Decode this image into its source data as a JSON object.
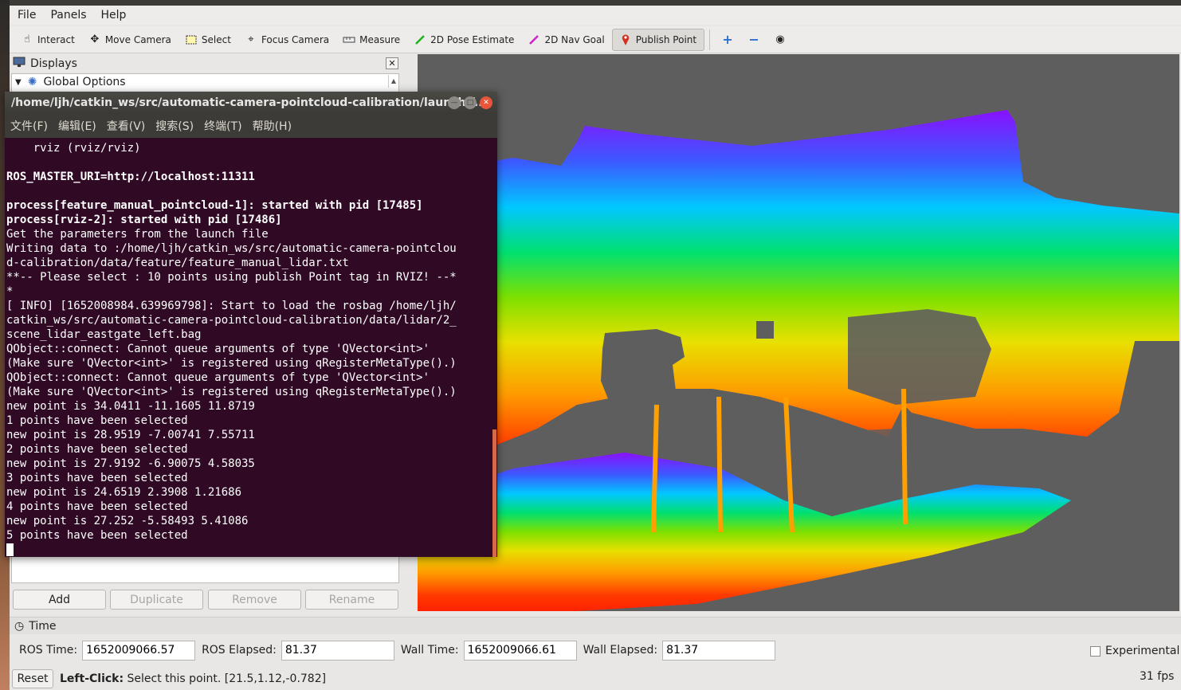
{
  "menubar": {
    "items": [
      "File",
      "Panels",
      "Help"
    ]
  },
  "toolbar": {
    "tools": [
      {
        "label": "Interact",
        "icon": "hand-pointer-icon"
      },
      {
        "label": "Move Camera",
        "icon": "move-camera-icon"
      },
      {
        "label": "Select",
        "icon": "select-box-icon"
      },
      {
        "label": "Focus Camera",
        "icon": "crosshair-icon"
      },
      {
        "label": "Measure",
        "icon": "ruler-icon"
      },
      {
        "label": "2D Pose Estimate",
        "icon": "green-arrow-icon"
      },
      {
        "label": "2D Nav Goal",
        "icon": "magenta-arrow-icon"
      },
      {
        "label": "Publish Point",
        "icon": "map-pin-icon"
      }
    ]
  },
  "displays": {
    "title": "Displays",
    "tree": {
      "global_options": "Global Options"
    },
    "buttons": {
      "add": "Add",
      "duplicate": "Duplicate",
      "remove": "Remove",
      "rename": "Rename"
    }
  },
  "terminal": {
    "title": "/home/ljh/catkin_ws/src/automatic-camera-pointcloud-calibration/launch/f...",
    "menu": [
      "文件(F)",
      "编辑(E)",
      "查看(V)",
      "搜索(S)",
      "终端(T)",
      "帮助(H)"
    ],
    "lines": [
      {
        "text": "    rviz (rviz/rviz)",
        "bold": false
      },
      {
        "text": "",
        "bold": false
      },
      {
        "text": "ROS_MASTER_URI=http://localhost:11311",
        "bold": true
      },
      {
        "text": "",
        "bold": false
      },
      {
        "text": "process[feature_manual_pointcloud-1]: started with pid [17485]",
        "bold": true
      },
      {
        "text": "process[rviz-2]: started with pid [17486]",
        "bold": true
      },
      {
        "text": "Get the parameters from the launch file",
        "bold": false
      },
      {
        "text": "Writing data to :/home/ljh/catkin_ws/src/automatic-camera-pointclou",
        "bold": false
      },
      {
        "text": "d-calibration/data/feature/feature_manual_lidar.txt",
        "bold": false
      },
      {
        "text": "**-- Please select : 10 points using publish Point tag in RVIZ! --*",
        "bold": false
      },
      {
        "text": "*",
        "bold": false
      },
      {
        "text": "[ INFO] [1652008984.639969798]: Start to load the rosbag /home/ljh/",
        "bold": false
      },
      {
        "text": "catkin_ws/src/automatic-camera-pointcloud-calibration/data/lidar/2_",
        "bold": false
      },
      {
        "text": "scene_lidar_eastgate_left.bag",
        "bold": false
      },
      {
        "text": "QObject::connect: Cannot queue arguments of type 'QVector<int>'",
        "bold": false
      },
      {
        "text": "(Make sure 'QVector<int>' is registered using qRegisterMetaType().)",
        "bold": false
      },
      {
        "text": "QObject::connect: Cannot queue arguments of type 'QVector<int>'",
        "bold": false
      },
      {
        "text": "(Make sure 'QVector<int>' is registered using qRegisterMetaType().)",
        "bold": false
      },
      {
        "text": "new point is 34.0411 -11.1605 11.8719",
        "bold": false
      },
      {
        "text": "1 points have been selected",
        "bold": false
      },
      {
        "text": "new point is 28.9519 -7.00741 7.55711",
        "bold": false
      },
      {
        "text": "2 points have been selected",
        "bold": false
      },
      {
        "text": "new point is 27.9192 -6.90075 4.58035",
        "bold": false
      },
      {
        "text": "3 points have been selected",
        "bold": false
      },
      {
        "text": "new point is 24.6519 2.3908 1.21686",
        "bold": false
      },
      {
        "text": "4 points have been selected",
        "bold": false
      },
      {
        "text": "new point is 27.252 -5.58493 5.41086",
        "bold": false
      },
      {
        "text": "5 points have been selected",
        "bold": false
      }
    ]
  },
  "time": {
    "title": "Time",
    "ros_time_label": "ROS Time:",
    "ros_time": "1652009066.57",
    "ros_elapsed_label": "ROS Elapsed:",
    "ros_elapsed": "81.37",
    "wall_time_label": "Wall Time:",
    "wall_time": "1652009066.61",
    "wall_elapsed_label": "Wall Elapsed:",
    "wall_elapsed": "81.37",
    "experimental": "Experimental"
  },
  "status": {
    "reset": "Reset",
    "hint_bold": "Left-Click:",
    "hint": " Select this point. [21.5,1.12,-0.782]",
    "fps": "31 fps"
  },
  "colors": {
    "terminal_bg": "#300a24",
    "view_bg": "#5e5e5e",
    "active_tool": "#dcdad6"
  }
}
